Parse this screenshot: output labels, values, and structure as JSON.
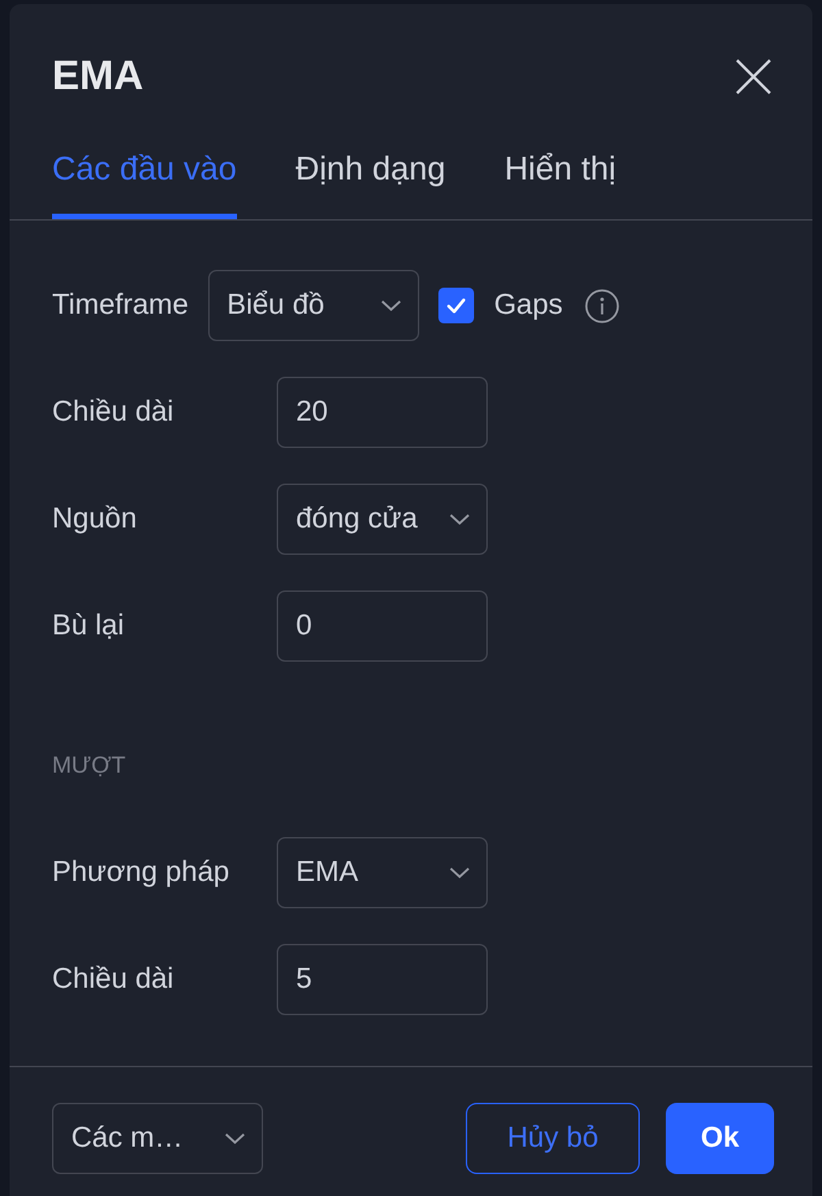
{
  "dialog": {
    "title": "EMA"
  },
  "tabs": [
    {
      "label": "Các đầu vào",
      "selected": true
    },
    {
      "label": "Định dạng",
      "selected": false
    },
    {
      "label": "Hiển thị",
      "selected": false
    }
  ],
  "fields": [
    {
      "kind": "select",
      "label": "Timeframe",
      "value": "Biểu đồ",
      "checkbox": {
        "label": "Gaps",
        "checked": true
      }
    },
    {
      "kind": "input",
      "label": "Chiều dài",
      "value": "20"
    },
    {
      "kind": "select",
      "label": "Nguồn",
      "value": "đóng cửa"
    },
    {
      "kind": "input",
      "label": "Bù lại",
      "value": "0"
    }
  ],
  "smoothing": {
    "heading": "MƯỢT",
    "fields": [
      {
        "kind": "select",
        "label": "Phương pháp",
        "value": "EMA"
      },
      {
        "kind": "input",
        "label": "Chiều dài",
        "value": "5"
      }
    ]
  },
  "footer": {
    "template": {
      "kind": "select",
      "value": "Các m…"
    },
    "buttons": [
      {
        "kind": "secondary",
        "label": "Hủy bỏ"
      },
      {
        "kind": "primary",
        "label": "Ok"
      }
    ]
  }
}
